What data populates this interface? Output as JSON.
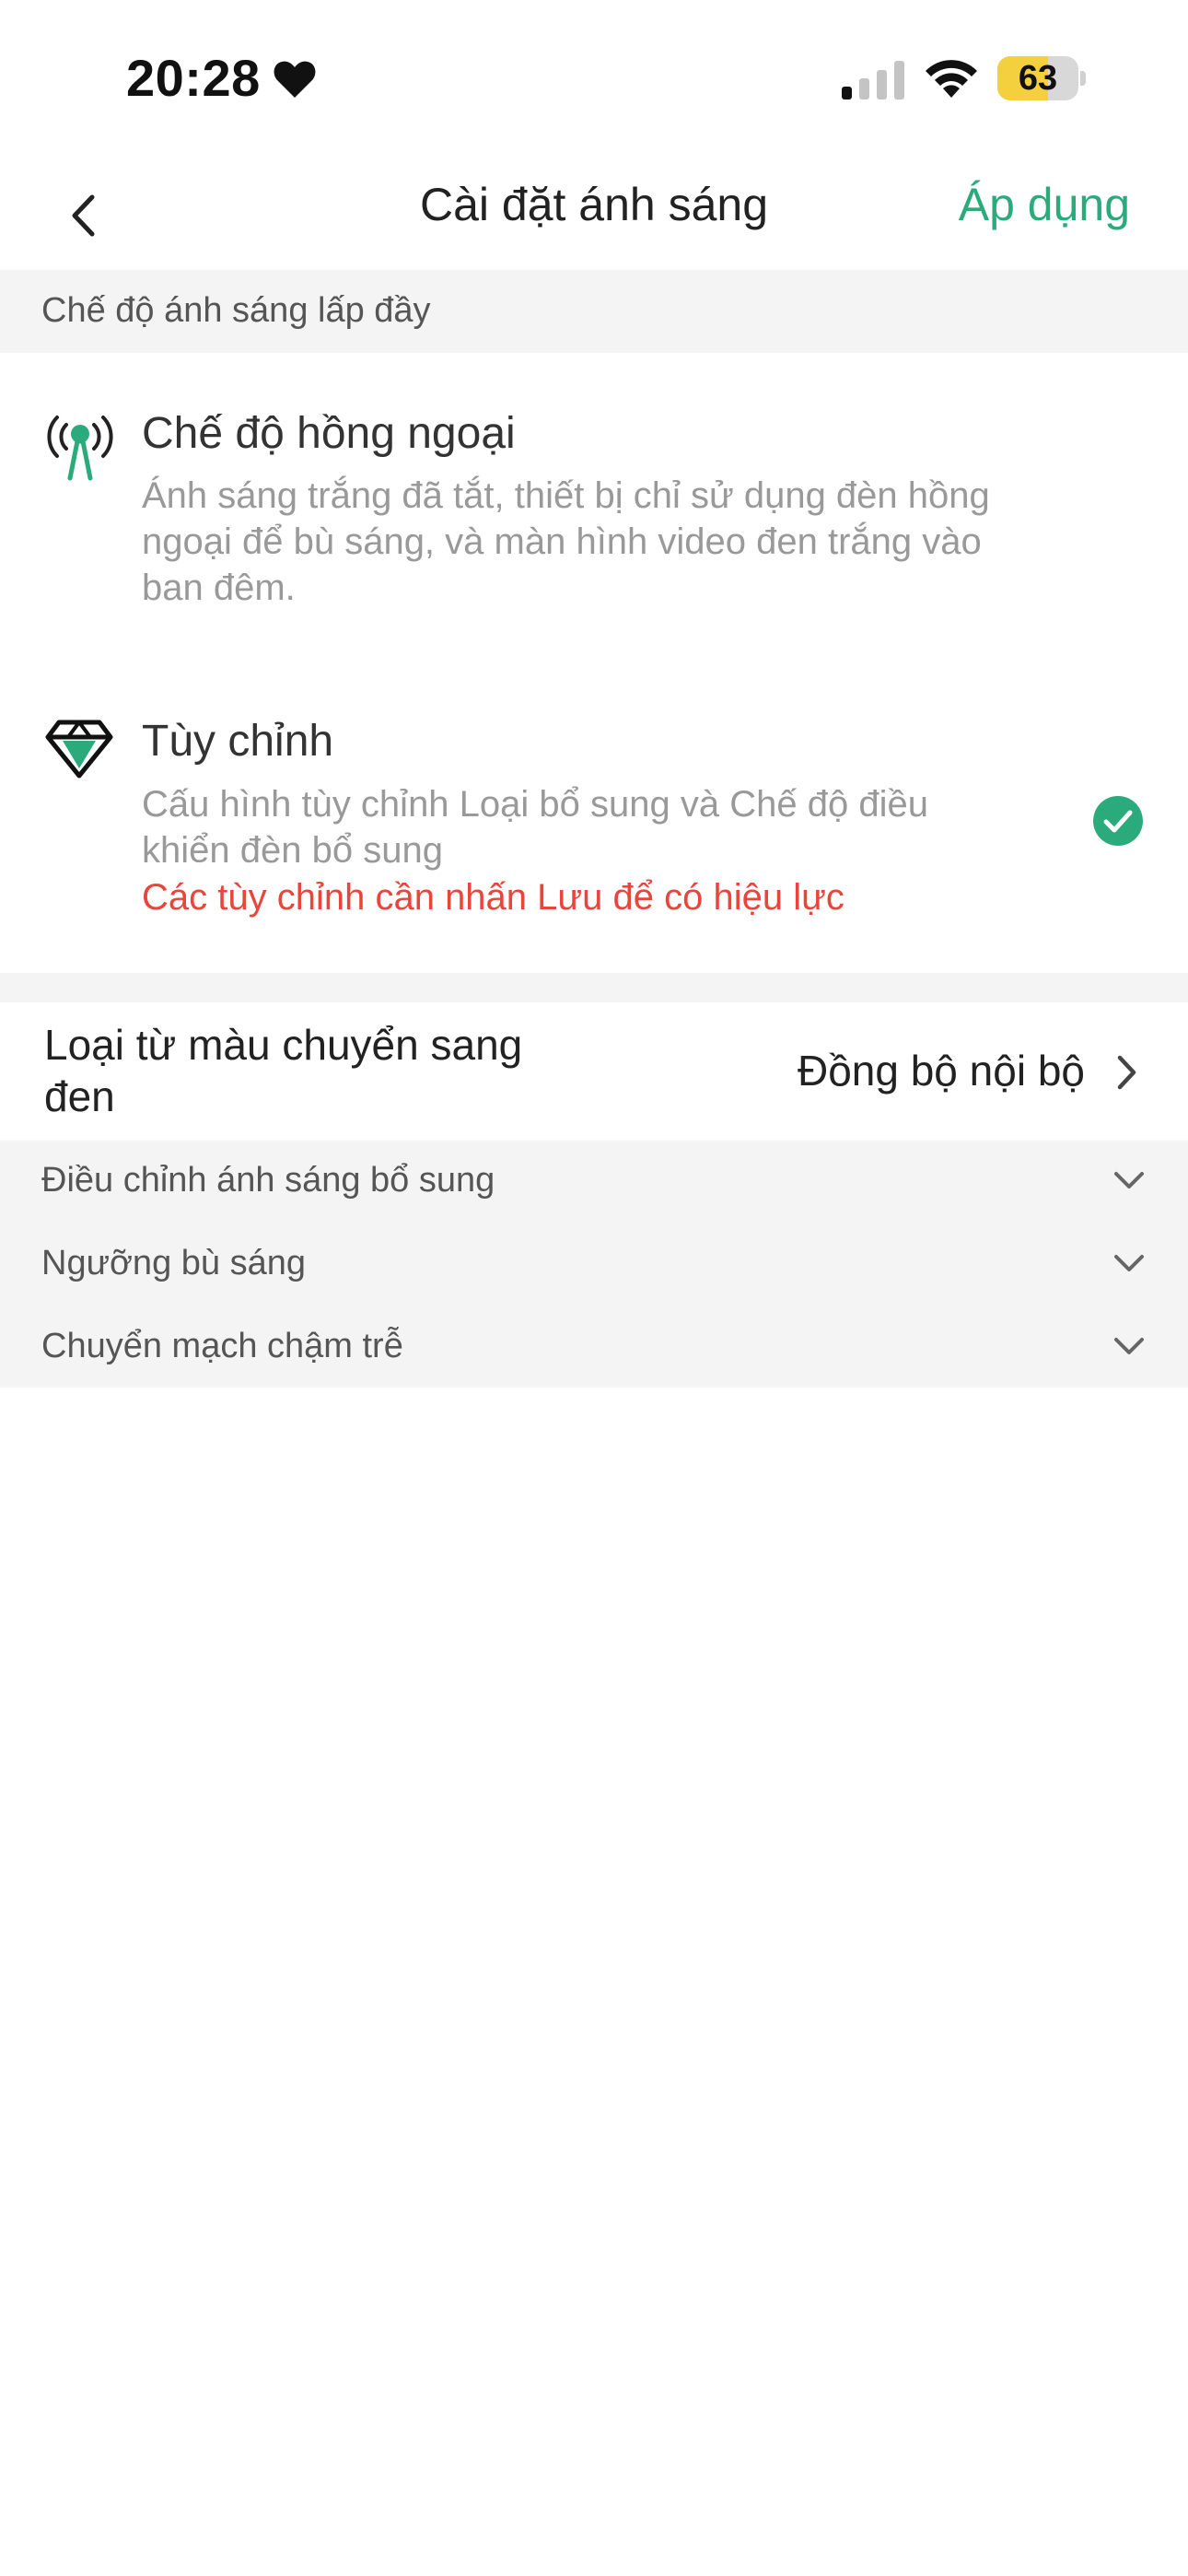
{
  "status_bar": {
    "time": "20:28",
    "battery": "63",
    "battery_level": 0.63
  },
  "nav": {
    "title": "Cài đặt ánh sáng",
    "apply_label": "Áp dụng"
  },
  "section": {
    "title": "Chế độ ánh sáng lấp đầy"
  },
  "modes": [
    {
      "title": "Chế độ hồng ngoại",
      "description": "Ánh sáng trắng đã tắt, thiết bị chỉ sử dụng đèn hồng ngoại để bù sáng, và màn hình video đen trắng vào ban đêm.",
      "icon": "infrared-icon",
      "selected": false
    },
    {
      "title": "Tùy chỉnh",
      "description": "Cấu hình tùy chỉnh Loại bổ sung và Chế độ điều khiển đèn bổ sung",
      "warning": "Các tùy chỉnh cần nhấn Lưu để có hiệu lực",
      "icon": "diamond-icon",
      "selected": true
    }
  ],
  "conversion": {
    "label": "Loại từ màu chuyển sang đen",
    "value": "Đồng bộ nội bộ"
  },
  "adjustments": [
    {
      "label": "Điều chỉnh ánh sáng bổ sung"
    },
    {
      "label": "Ngưỡng bù sáng"
    },
    {
      "label": "Chuyển mạch chậm trễ"
    }
  ],
  "colors": {
    "accent": "#2bab7b",
    "warning": "#e8453c",
    "battery": "#f4d03f",
    "section_bg": "#f4f4f4"
  }
}
